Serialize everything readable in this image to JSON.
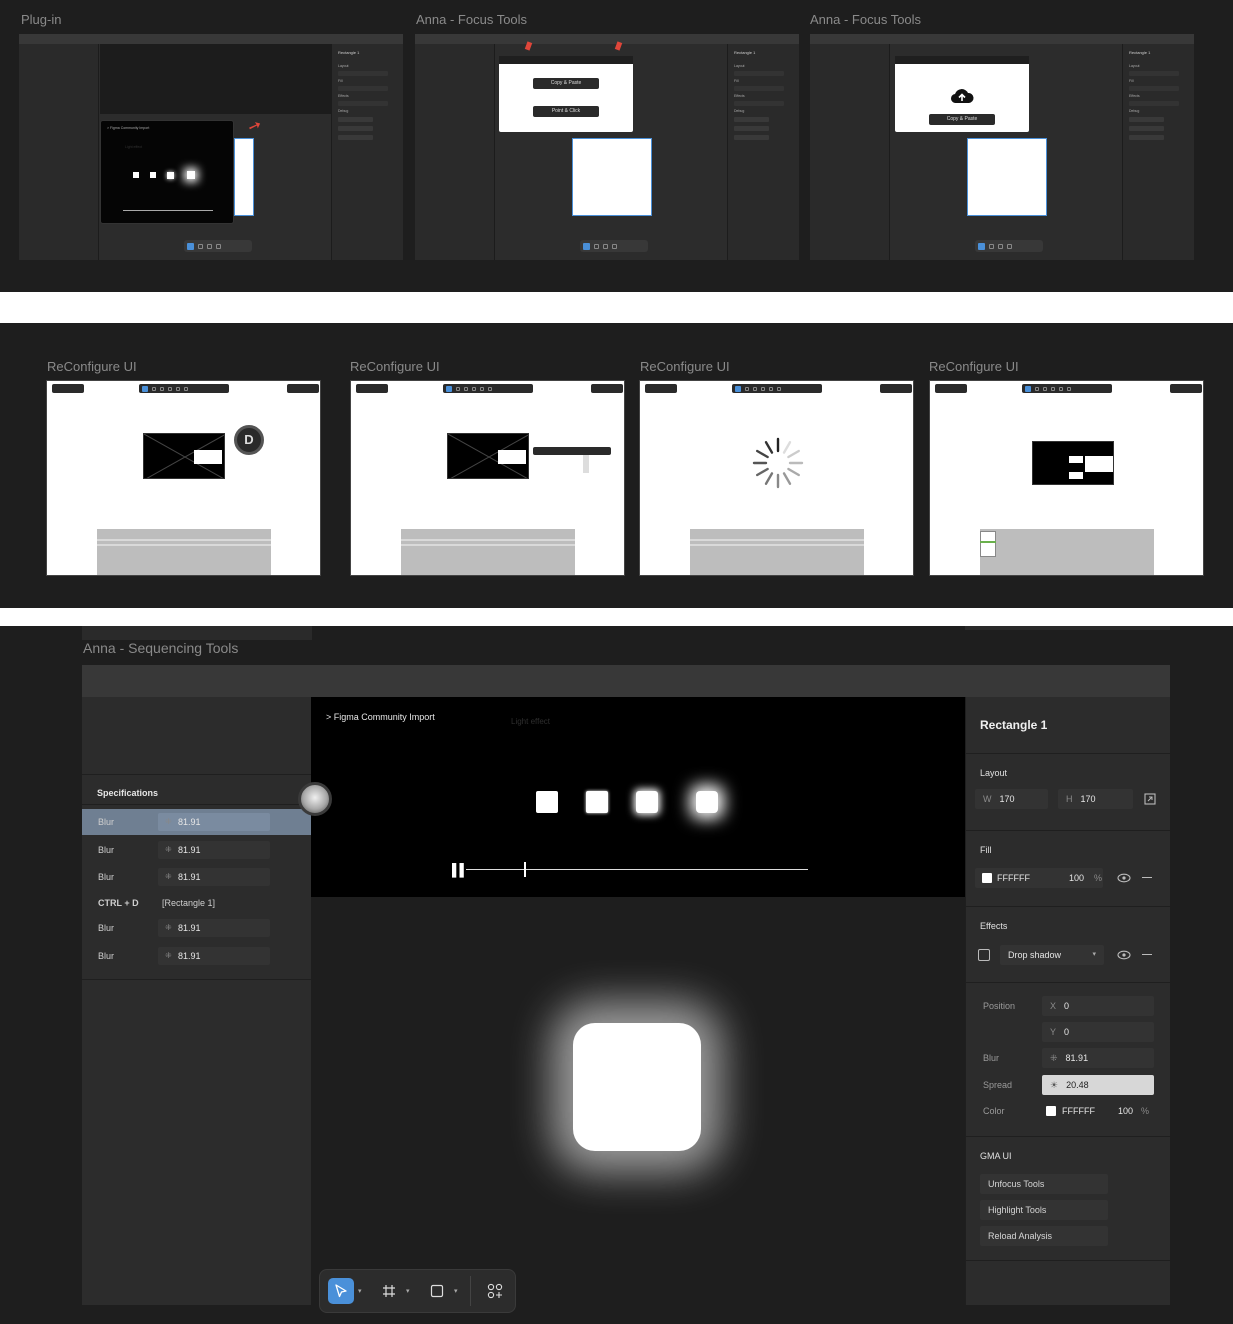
{
  "band1": {
    "frames": [
      {
        "label": "Plug-in",
        "props_title": "Rectangle 1",
        "props_sections": [
          "Layout",
          "Fill",
          "Effects",
          "Debug"
        ],
        "props_buttons": [
          "Unfocus Tools",
          "Highlight Tools",
          "Reload Analysis"
        ],
        "popup_title": "Light effect",
        "popup_subtitle": "> Figma Community Import"
      },
      {
        "label": "Anna - Focus Tools",
        "props_title": "Rectangle 1",
        "props_sections": [
          "Layout",
          "Fill",
          "Effects",
          "Debug"
        ],
        "props_buttons": [
          "Unfocus Tools",
          "Highlight Tools",
          "Reload Analysis"
        ],
        "popup_btn1": "Copy & Paste",
        "popup_btn2": "Point & Click"
      },
      {
        "label": "Anna - Focus Tools",
        "props_title": "Rectangle 1",
        "props_sections": [
          "Layout",
          "Fill",
          "Effects",
          "Debug"
        ],
        "props_buttons": [
          "Unfocus Tools",
          "Highlight Tools",
          "Reload Analysis"
        ],
        "popup_btn1": "Copy & Paste"
      }
    ]
  },
  "band2": {
    "frames": [
      {
        "label": "ReConfigure UI",
        "badge": "D"
      },
      {
        "label": "ReConfigure UI"
      },
      {
        "label": "ReConfigure UI"
      },
      {
        "label": "ReConfigure UI"
      }
    ]
  },
  "band3": {
    "label": "Anna - Sequencing Tools",
    "video": {
      "title": "> Figma Community Import",
      "subtitle": "Light effect",
      "progress": 0.17
    },
    "specs": {
      "heading": "Specifications",
      "rows": [
        {
          "label": "Blur",
          "value": "81.91",
          "highlight": true
        },
        {
          "label": "Blur",
          "value": "81.91"
        },
        {
          "label": "Blur",
          "value": "81.91"
        },
        {
          "label": "CTRL + D",
          "value": "[Rectangle 1]"
        },
        {
          "label": "Blur",
          "value": "81.91"
        },
        {
          "label": "Blur",
          "value": "81.91"
        }
      ]
    },
    "props": {
      "title": "Rectangle 1",
      "layout": {
        "heading": "Layout",
        "w_key": "W",
        "w": "170",
        "h_key": "H",
        "h": "170"
      },
      "fill": {
        "heading": "Fill",
        "hex": "FFFFFF",
        "opacity": "100",
        "pct": "%"
      },
      "effects": {
        "heading": "Effects",
        "type": "Drop shadow"
      },
      "shadow": {
        "position_label": "Position",
        "x_key": "X",
        "x": "0",
        "y_key": "Y",
        "y": "0",
        "blur_label": "Blur",
        "blur": "81.91",
        "spread_label": "Spread",
        "spread": "20.48",
        "color_label": "Color",
        "color_hex": "FFFFFF",
        "color_opacity": "100",
        "pct": "%"
      },
      "gma": {
        "heading": "GMA UI",
        "buttons": [
          "Unfocus Tools",
          "Highlight Tools",
          "Reload Analysis"
        ]
      }
    }
  },
  "colors": {
    "accent": "#4a90d9",
    "bg_dark": "#1e1e1e",
    "panel": "#2c2c2c",
    "focus_arrow": "#e0463a"
  },
  "icons": [
    "cursor-icon",
    "frame-icon",
    "rectangle-icon",
    "components-icon",
    "eye-icon",
    "minus-icon",
    "resize-icon",
    "upload-cloud-icon",
    "pause-icon",
    "blur-icon",
    "spread-icon"
  ]
}
